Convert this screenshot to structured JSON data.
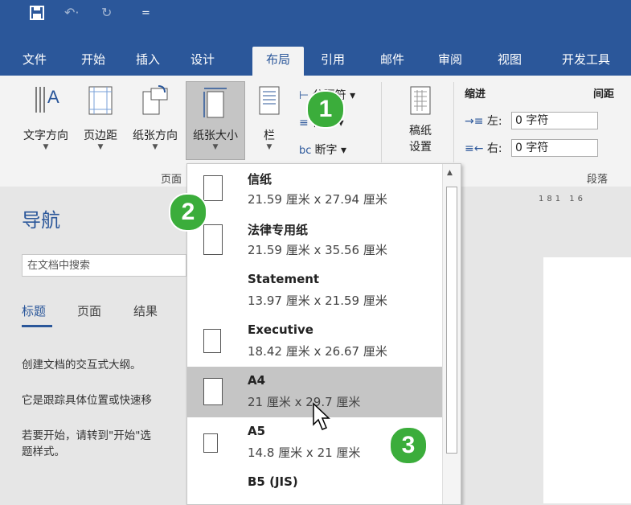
{
  "qat": {
    "save_icon": "💾",
    "undo": "↶·",
    "redo": "↻",
    "more": "="
  },
  "tabs": [
    "文件",
    "开始",
    "插入",
    "设计",
    "布局",
    "引用",
    "邮件",
    "审阅",
    "视图",
    "开发工具"
  ],
  "ribbon": {
    "text_direction": "文字方向",
    "margins": "页边距",
    "orientation": "纸张方向",
    "size": "纸张大小",
    "columns": "栏",
    "breaks": "分隔符",
    "line_numbers": "行号",
    "hyphenation": "断字",
    "manuscript_line1": "稿纸",
    "manuscript_line2": "设置",
    "indent": "缩进",
    "spacing": "间距",
    "left_label": "左:",
    "right_label": "右:",
    "left_value": "0 字符",
    "right_value": "0 字符",
    "group_page": "页面",
    "group_paragraph": "段落"
  },
  "nav": {
    "title": "导航",
    "search_placeholder": "在文档中搜索",
    "tab_headings": "标题",
    "tab_pages": "页面",
    "tab_results": "结果",
    "p1": "创建文档的交互式大纲。",
    "p2": "它是跟踪具体位置或快速移",
    "p3a": "若要开始，请转到\"开始\"选",
    "p3b": "题样式。"
  },
  "ruler": "181 16",
  "paper_sizes": [
    {
      "name": "信纸",
      "size": "21.59 厘米 x 27.94 厘米"
    },
    {
      "name": "法律专用纸",
      "size": "21.59 厘米 x 35.56 厘米"
    },
    {
      "name": "Statement",
      "size": "13.97 厘米 x 21.59 厘米"
    },
    {
      "name": "Executive",
      "size": "18.42 厘米 x 26.67 厘米"
    },
    {
      "name": "A4",
      "size": "21 厘米 x 29.7 厘米"
    },
    {
      "name": "A5",
      "size": "14.8 厘米 x 21 厘米"
    },
    {
      "name": "B5 (JIS)",
      "size": ""
    }
  ],
  "badges": [
    "1",
    "2",
    "3"
  ],
  "colors": {
    "accent": "#2b579a",
    "badge": "#3bad3b",
    "highlight": "#c5c5c5"
  }
}
